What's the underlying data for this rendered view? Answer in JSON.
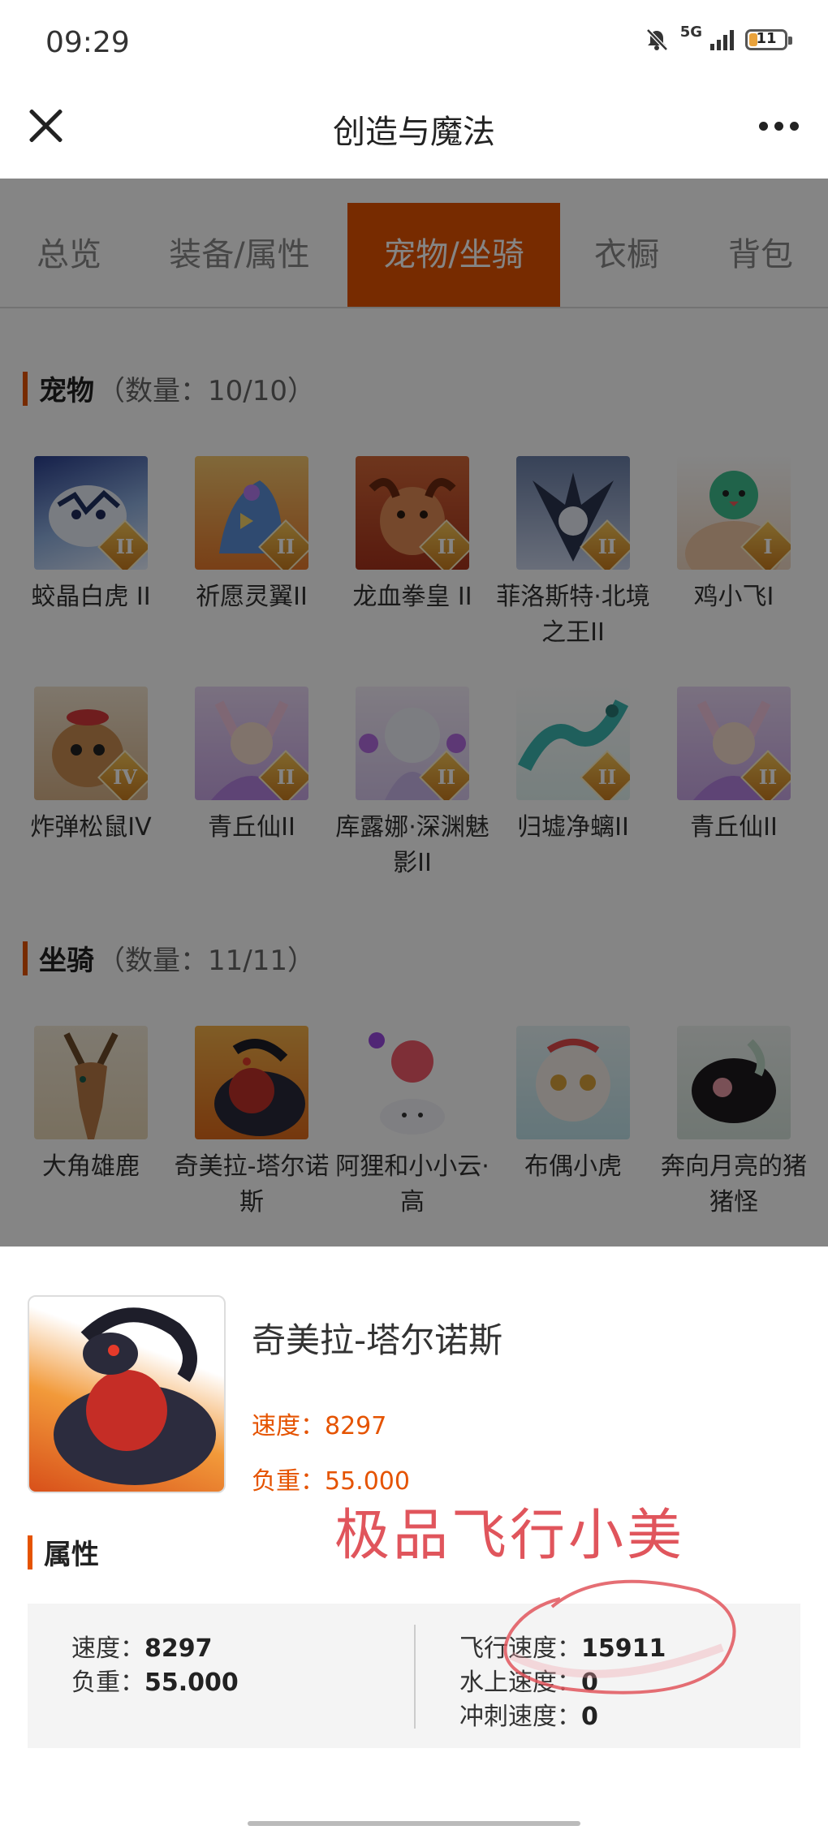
{
  "status": {
    "time": "09:29",
    "network": "5G",
    "battery": "11"
  },
  "header": {
    "title": "创造与魔法"
  },
  "tabs": [
    {
      "label": "总览",
      "active": false
    },
    {
      "label": "装备/属性",
      "active": false
    },
    {
      "label": "宠物/坐骑",
      "active": true
    },
    {
      "label": "衣橱",
      "active": false
    },
    {
      "label": "背包",
      "active": false
    }
  ],
  "pets": {
    "title": "宠物",
    "count": "（数量：10/10）",
    "items": [
      {
        "name": "蛟晶白虎 II",
        "grade": "II"
      },
      {
        "name": "祈愿灵翼II",
        "grade": "II"
      },
      {
        "name": "龙血拳皇 II",
        "grade": "II"
      },
      {
        "name": "菲洛斯特·北境之王II",
        "grade": "II"
      },
      {
        "name": "鸡小飞I",
        "grade": "I"
      },
      {
        "name": "炸弹松鼠IV",
        "grade": "IV"
      },
      {
        "name": "青丘仙II",
        "grade": "II"
      },
      {
        "name": "库露娜·深渊魅影II",
        "grade": "II"
      },
      {
        "name": "归墟净螭II",
        "grade": "II"
      },
      {
        "name": "青丘仙II",
        "grade": "II"
      }
    ]
  },
  "mounts": {
    "title": "坐骑",
    "count": "（数量：11/11）",
    "items": [
      {
        "name": "大角雄鹿"
      },
      {
        "name": "奇美拉-塔尔诺斯"
      },
      {
        "name": "阿狸和小小云·高"
      },
      {
        "name": "布偶小虎"
      },
      {
        "name": "奔向月亮的猪猪怪"
      }
    ]
  },
  "detail": {
    "name": "奇美拉-塔尔诺斯",
    "speed": "速度：8297",
    "load": "负重：55.000",
    "attr_title": "属性",
    "left": [
      {
        "label": "速度：",
        "value": "8297"
      },
      {
        "label": "负重：",
        "value": "55.000"
      }
    ],
    "right": [
      {
        "label": "飞行速度：",
        "value": "15911"
      },
      {
        "label": "水上速度：",
        "value": "0"
      },
      {
        "label": "冲刺速度：",
        "value": "0"
      }
    ]
  },
  "annotation": "极品飞行小美",
  "colors": {
    "accent": "#e55300",
    "annotation": "#e0555c"
  }
}
